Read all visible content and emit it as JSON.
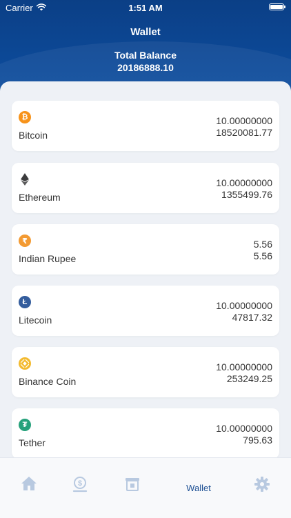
{
  "status_bar": {
    "carrier": "Carrier",
    "time": "1:51 AM"
  },
  "header": {
    "title": "Wallet",
    "total_label": "Total Balance",
    "total_value": "20186888.10"
  },
  "coins": [
    {
      "name": "Bitcoin",
      "amount": "10.00000000",
      "value": "18520081.77",
      "icon": "bitcoin-icon",
      "symbol": "₿",
      "color": "#f7931a"
    },
    {
      "name": "Ethereum",
      "amount": "10.00000000",
      "value": "1355499.76",
      "icon": "ethereum-icon",
      "symbol": "",
      "color": "#3c3c3d"
    },
    {
      "name": "Indian Rupee",
      "amount": "5.56",
      "value": "5.56",
      "icon": "rupee-icon",
      "symbol": "₹",
      "color": "#f39a32"
    },
    {
      "name": "Litecoin",
      "amount": "10.00000000",
      "value": "47817.32",
      "icon": "litecoin-icon",
      "symbol": "Ł",
      "color": "#345d9d"
    },
    {
      "name": "Binance Coin",
      "amount": "10.00000000",
      "value": "253249.25",
      "icon": "binance-icon",
      "symbol": "",
      "color": "#f3ba2f"
    },
    {
      "name": "Tether",
      "amount": "10.00000000",
      "value": "795.63",
      "icon": "tether-icon",
      "symbol": "₮",
      "color": "#26a17b"
    }
  ],
  "tabbar": {
    "tabs": [
      {
        "icon": "home-icon",
        "label": ""
      },
      {
        "icon": "dollar-icon",
        "label": ""
      },
      {
        "icon": "atm-icon",
        "label": ""
      },
      {
        "icon": "",
        "label": "Wallet",
        "active": true
      },
      {
        "icon": "gear-icon",
        "label": ""
      }
    ],
    "inactive_color": "#b8c9e0",
    "active_color": "#1c4f93"
  }
}
